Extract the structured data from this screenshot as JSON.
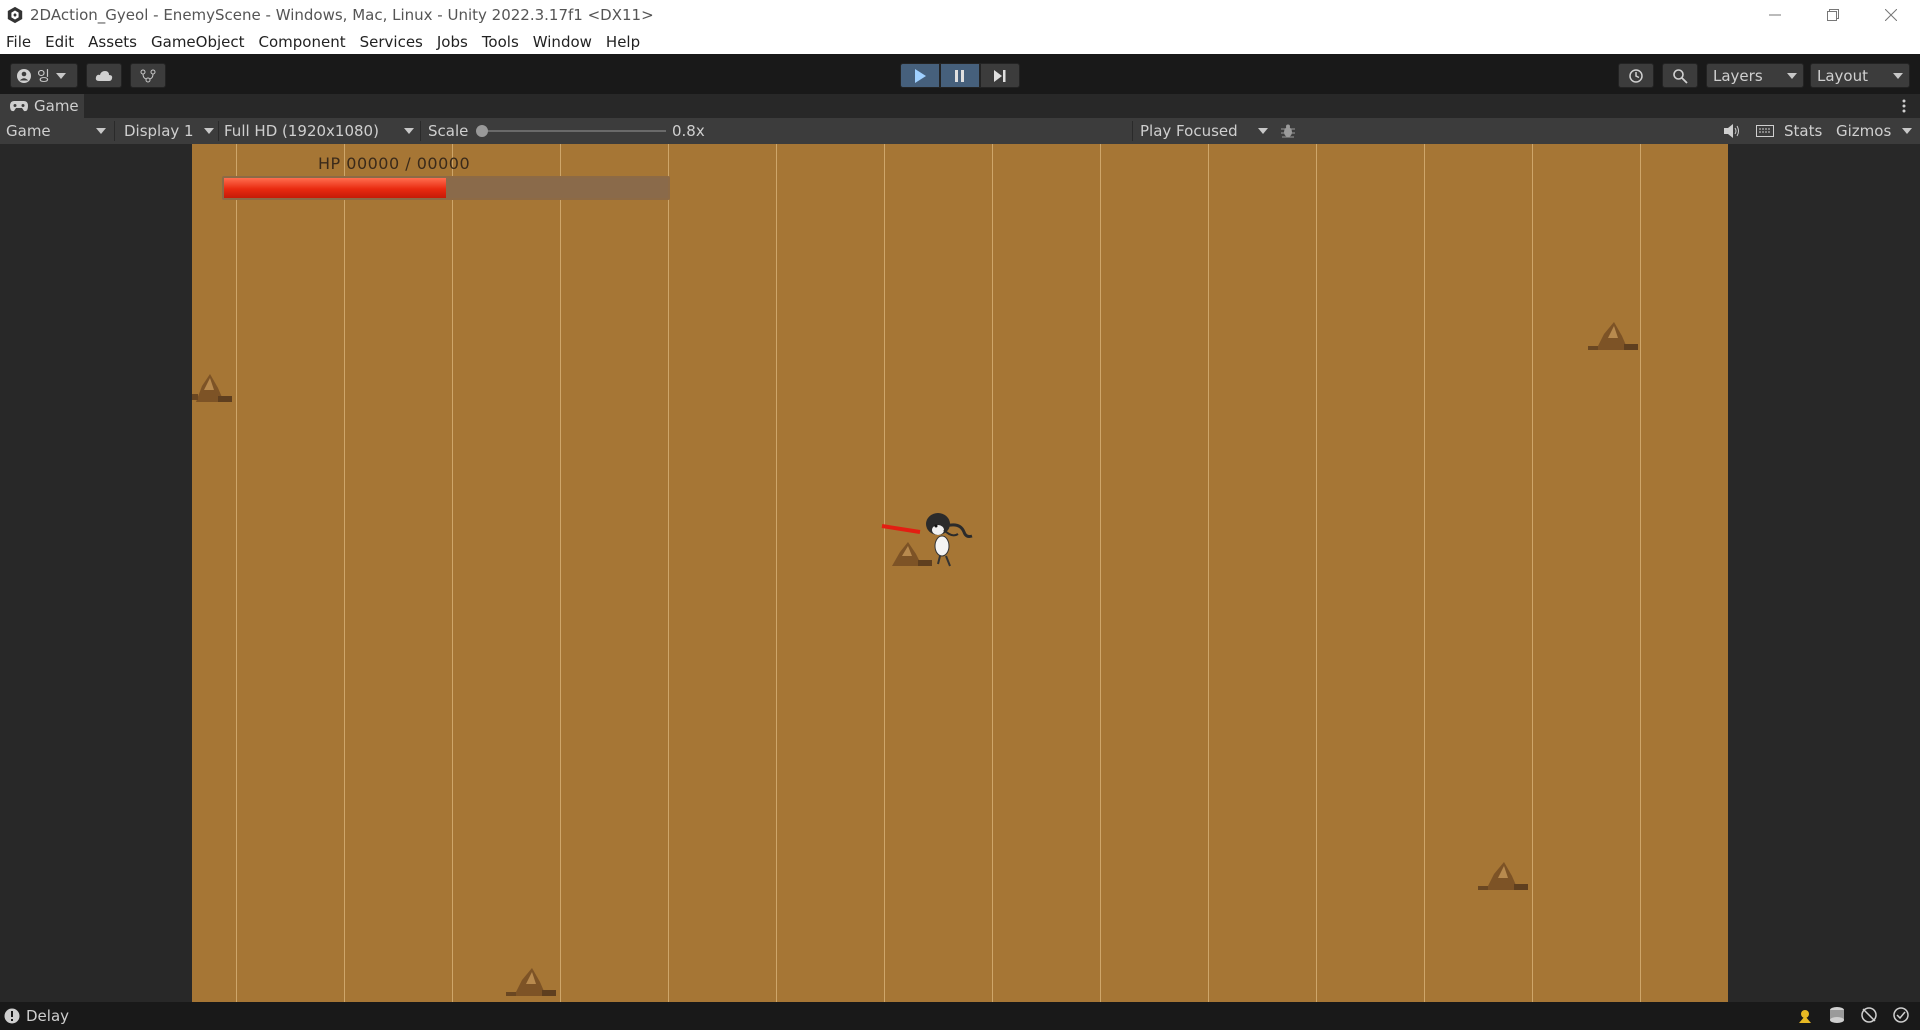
{
  "window": {
    "title": "2DAction_Gyeol - EnemyScene - Windows, Mac, Linux - Unity 2022.3.17f1 <DX11>",
    "minimize_icon": "minimize-icon",
    "restore_icon": "restore-icon",
    "close_icon": "close-icon"
  },
  "menu": [
    "File",
    "Edit",
    "Assets",
    "GameObject",
    "Component",
    "Services",
    "Jobs",
    "Tools",
    "Window",
    "Help"
  ],
  "toolbar": {
    "account_label": "잉",
    "layers_label": "Layers",
    "layout_label": "Layout"
  },
  "tab": {
    "label": "Game"
  },
  "game_bar": {
    "mode": "Game",
    "display": "Display 1",
    "resolution": "Full HD (1920x1080)",
    "scale_label": "Scale",
    "scale_value": "0.8x",
    "play_mode": "Play Focused",
    "stats_label": "Stats",
    "gizmos_label": "Gizmos"
  },
  "game_view": {
    "hp_text": "HP  00000  /  00000",
    "hp_fraction": 0.5,
    "colors": {
      "ground": "#a67635",
      "hp_fill": "#e92a10"
    }
  },
  "status": {
    "text": "Delay"
  }
}
